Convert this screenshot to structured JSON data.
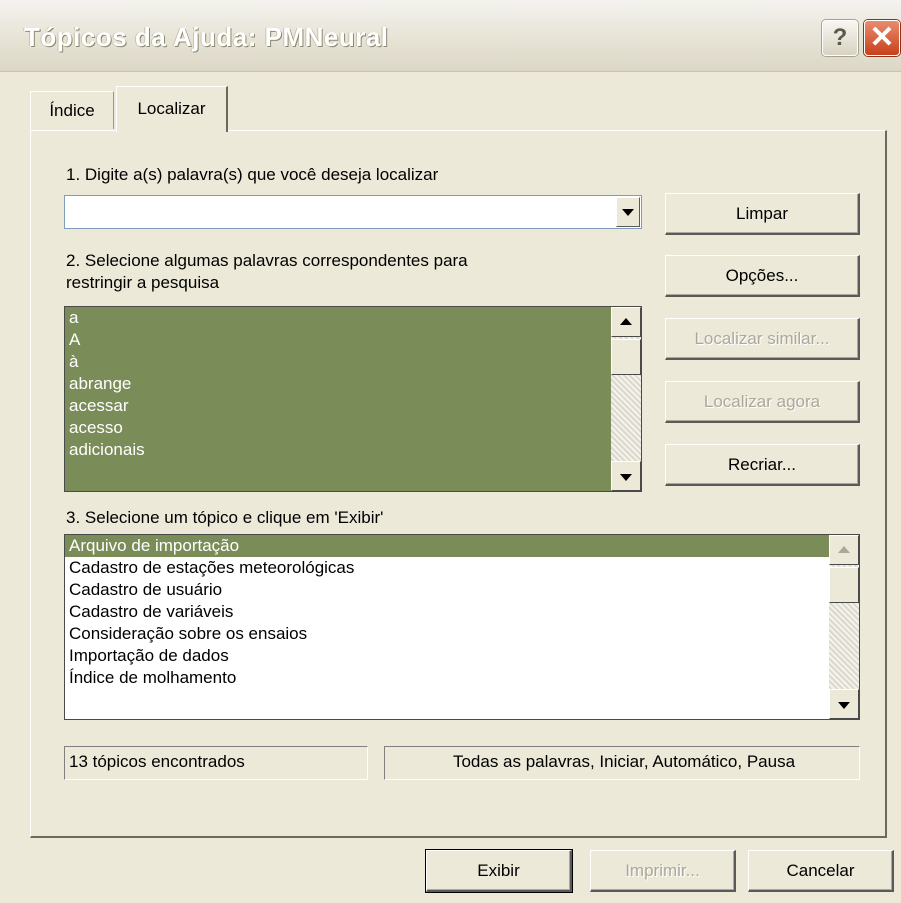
{
  "window": {
    "title": "Tópicos da Ajuda: PMNeural",
    "help_glyph": "?",
    "close_glyph": "✕"
  },
  "tabs": [
    {
      "label": "Índice",
      "active": false
    },
    {
      "label": "Localizar",
      "active": true
    }
  ],
  "step1": {
    "label": "1. Digite a(s) palavra(s) que você deseja localizar",
    "value": ""
  },
  "step2": {
    "label_line1": "2. Selecione algumas palavras correspondentes para",
    "label_line2": "restringir a pesquisa",
    "words": [
      "a",
      "A",
      "à",
      "abrange",
      "acessar",
      "acesso",
      "adicionais"
    ]
  },
  "step3": {
    "label": "3. Selecione um tópico e clique em 'Exibir'",
    "topics": [
      "Arquivo de importação",
      "Cadastro de estações meteorológicas",
      "Cadastro de usuário",
      "Cadastro de variáveis",
      "Consideração sobre os ensaios",
      "Importação de dados",
      "Índice de molhamento"
    ],
    "selected_index": 0
  },
  "side_buttons": {
    "limpar": "Limpar",
    "opcoes": "Opções...",
    "localizar_similar": "Localizar similar...",
    "localizar_agora": "Localizar agora",
    "recriar": "Recriar..."
  },
  "status": {
    "count": "13 tópicos encontrados",
    "options": "Todas as palavras, Iniciar, Automático, Pausa"
  },
  "bottom_buttons": {
    "exibir": "Exibir",
    "imprimir": "Imprimir...",
    "cancelar": "Cancelar"
  },
  "colors": {
    "dialog_bg": "#ece9d8",
    "selection": "#7a8c57",
    "close_red": "#c8401c"
  }
}
